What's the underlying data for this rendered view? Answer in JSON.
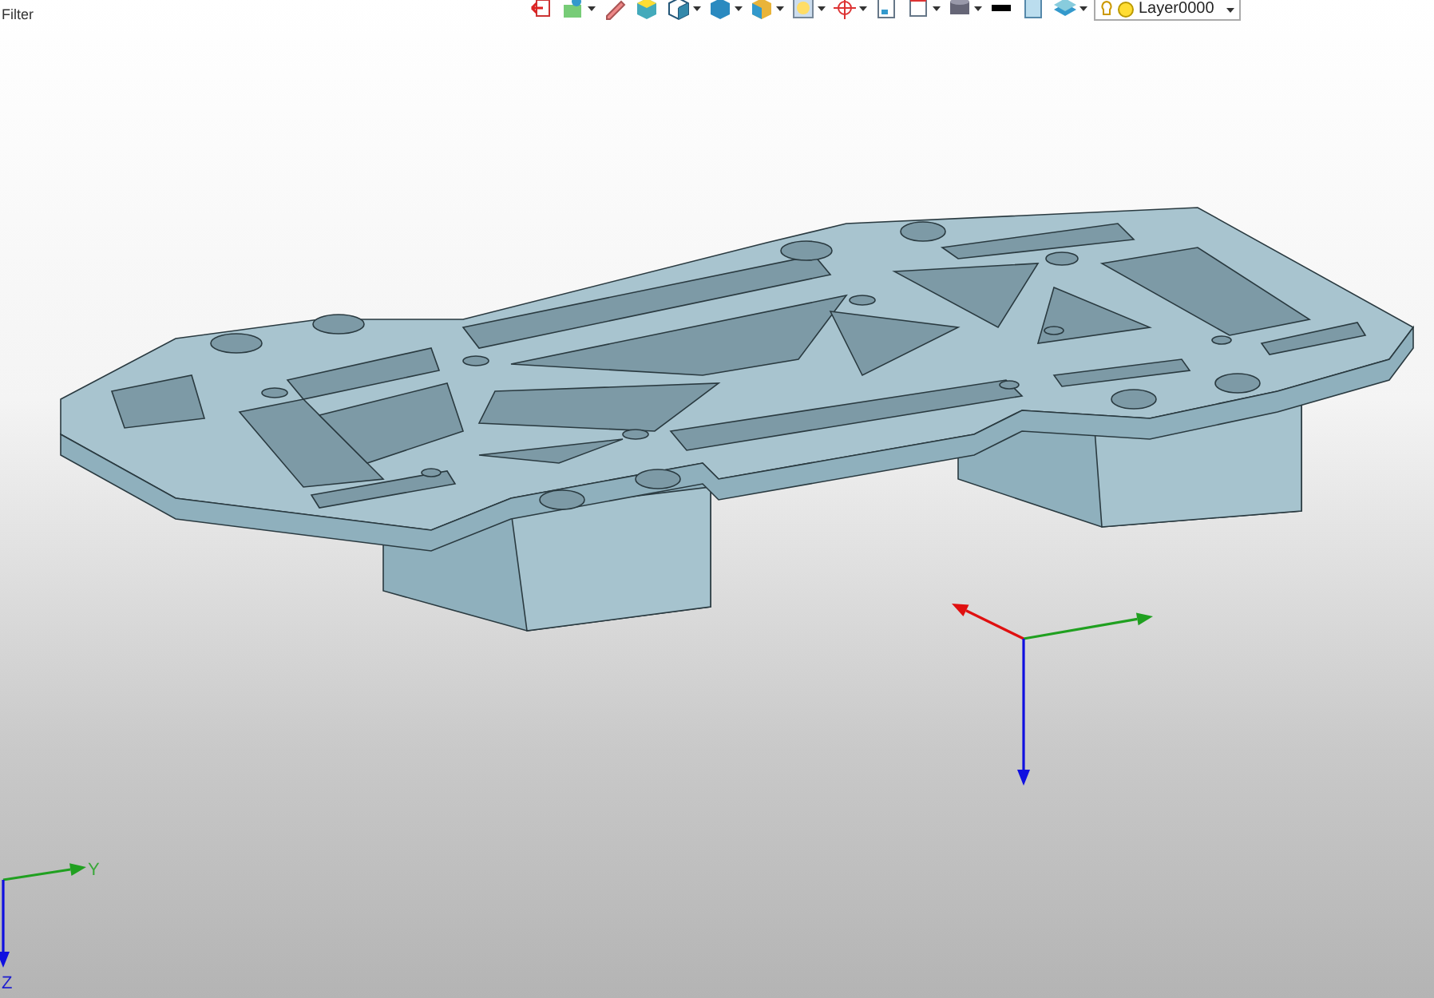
{
  "filter_label": "Filter",
  "toolbar": {
    "tools": [
      {
        "kind": "exit",
        "dropdown": false
      },
      {
        "kind": "paint",
        "dropdown": true
      },
      {
        "kind": "pencil",
        "dropdown": false
      },
      {
        "kind": "cube",
        "dropdown": false
      },
      {
        "kind": "cube-wire",
        "dropdown": true
      },
      {
        "kind": "cube-blue",
        "dropdown": true
      },
      {
        "kind": "cube-gold",
        "dropdown": true
      },
      {
        "kind": "view",
        "dropdown": true
      },
      {
        "kind": "target",
        "dropdown": true
      },
      {
        "kind": "doc",
        "dropdown": false
      },
      {
        "kind": "frame",
        "dropdown": true
      },
      {
        "kind": "cylinder",
        "dropdown": true
      },
      {
        "kind": "line",
        "dropdown": false
      },
      {
        "kind": "sheet",
        "dropdown": false
      },
      {
        "kind": "layers",
        "dropdown": true
      }
    ],
    "layer_dropdown": {
      "value": "Layer0000"
    }
  },
  "corner_triad": {
    "labels": [
      "Y",
      "Z"
    ]
  }
}
